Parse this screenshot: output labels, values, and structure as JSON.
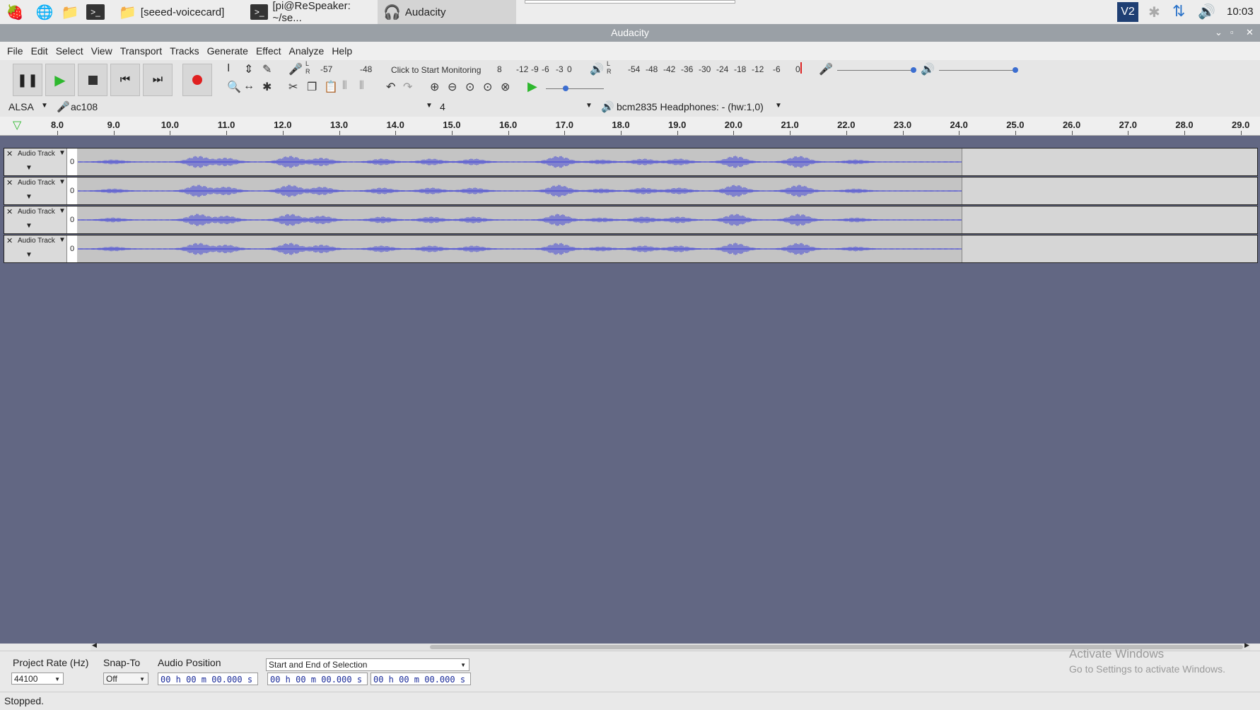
{
  "taskbar": {
    "windows": [
      {
        "label": "[seeed-voicecard]",
        "icon": "folder-icon"
      },
      {
        "label": "[pi@ReSpeaker: ~/se...",
        "icon": "terminal-icon"
      },
      {
        "label": "Audacity",
        "icon": "audacity-icon",
        "active": true
      }
    ],
    "clock": "10:03"
  },
  "window": {
    "title": "Audacity"
  },
  "menu": [
    "File",
    "Edit",
    "Select",
    "View",
    "Transport",
    "Tracks",
    "Generate",
    "Effect",
    "Analyze",
    "Help"
  ],
  "record_meter": {
    "l": "L",
    "r": "R",
    "ticks": [
      "-57",
      "-48"
    ],
    "monitor_label": "Click to Start Monitoring",
    "right_ticks": [
      "-12",
      "-9",
      "-6",
      "-3",
      "0"
    ],
    "frag": "8"
  },
  "play_meter": {
    "l": "L",
    "r": "R",
    "ticks": [
      "-54",
      "-48",
      "-42",
      "-36",
      "-30",
      "-24",
      "-18",
      "-12",
      "-6",
      "0"
    ]
  },
  "device": {
    "host": "ALSA",
    "input": "ac108",
    "channels": "4",
    "output": "bcm2835 Headphones: - (hw:1,0)"
  },
  "ruler": [
    "8.0",
    "9.0",
    "10.0",
    "11.0",
    "12.0",
    "13.0",
    "14.0",
    "15.0",
    "16.0",
    "17.0",
    "18.0",
    "19.0",
    "20.0",
    "21.0",
    "22.0",
    "23.0",
    "24.0",
    "25.0",
    "26.0",
    "27.0",
    "28.0",
    "29.0"
  ],
  "tracks": [
    {
      "name": "Audio Track",
      "scale": "0"
    },
    {
      "name": "Audio Track",
      "scale": "0"
    },
    {
      "name": "Audio Track",
      "scale": "0"
    },
    {
      "name": "Audio Track",
      "scale": "0"
    }
  ],
  "selection": {
    "project_rate_label": "Project Rate (Hz)",
    "project_rate": "44100",
    "snap_label": "Snap-To",
    "snap": "Off",
    "audio_pos_label": "Audio Position",
    "audio_pos": "00 h 00 m 00.000 s",
    "sel_mode": "Start and End of Selection",
    "sel_start": "00 h 00 m 00.000 s",
    "sel_end": "00 h 00 m 00.000 s"
  },
  "watermark": {
    "title": "Activate Windows",
    "sub": "Go to Settings to activate Windows."
  },
  "status": "Stopped.",
  "colors": {
    "wave": "#3c3fd6",
    "trackarea": "#626783",
    "titlebar": "#9aa0a6"
  }
}
